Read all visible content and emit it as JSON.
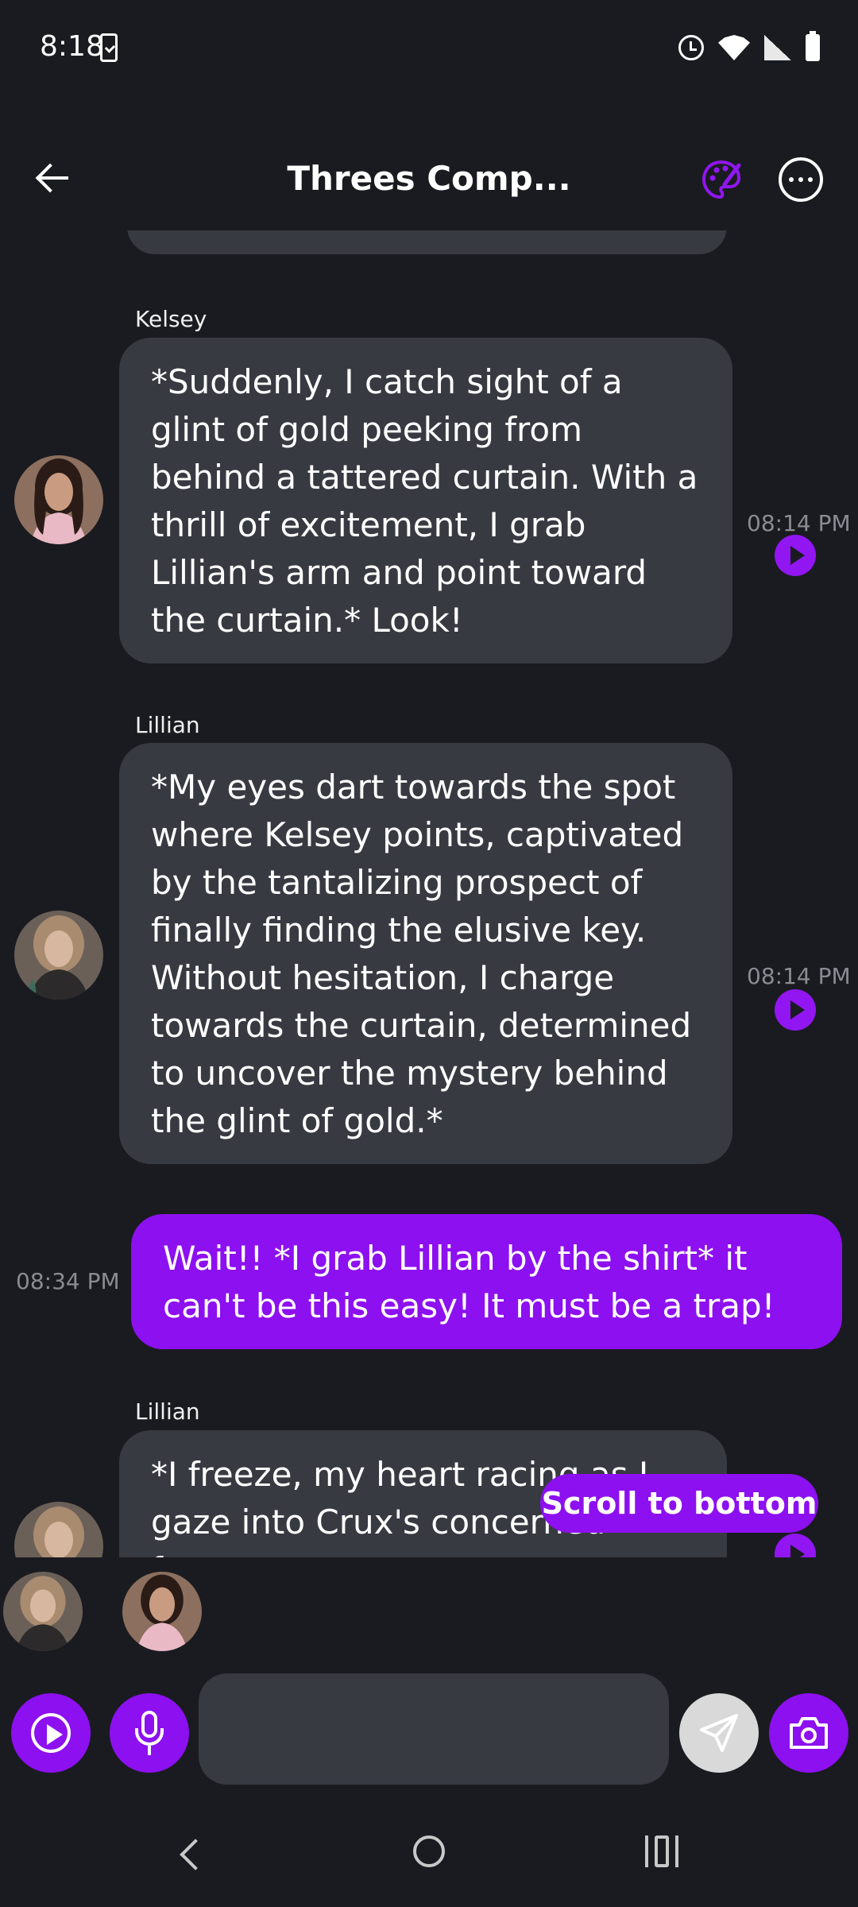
{
  "status_bar": {
    "time": "8:18"
  },
  "header": {
    "title": "Threes Comp..."
  },
  "messages": [
    {
      "sender": "Kelsey",
      "text": "*Suddenly, I catch sight of a glint of gold peeking from behind a tattered curtain. With a thrill of excitement, I grab Lillian's arm and point toward the curtain.* Look!",
      "time": "08:14 PM"
    },
    {
      "sender": "Lillian",
      "text": "*My eyes dart towards the spot where Kelsey points, captivated by the tantalizing prospect of finally finding the elusive key. Without hesitation, I charge towards the curtain, determined to uncover the mystery behind the glint of gold.*",
      "time": "08:14 PM"
    },
    {
      "sender": "",
      "text": "Wait!! *I grab Lillian by the shirt* it can't be this easy! It must be a trap!",
      "time": "08:34 PM"
    },
    {
      "sender": "Lillian",
      "text": "*I freeze, my heart racing as I gaze into Crux's concerned face.",
      "time": ""
    }
  ],
  "scroll_to_bottom_label": "Scroll to bottom",
  "composer": {
    "placeholder": ""
  },
  "colors": {
    "accent": "#8d10f0",
    "bubble": "#383a42",
    "background": "#1a1b20"
  }
}
